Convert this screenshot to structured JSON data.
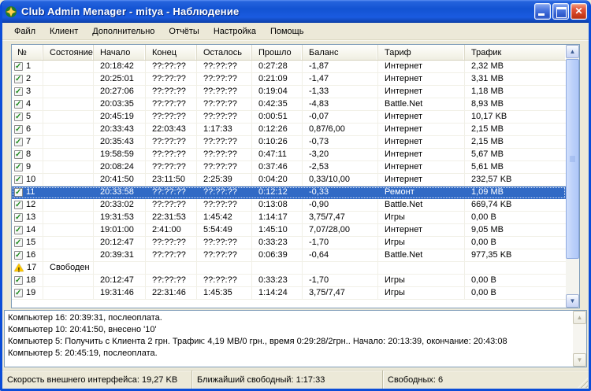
{
  "window": {
    "title": "Club Admin Menager - mitya - Наблюдение"
  },
  "menu": {
    "items": [
      "Файл",
      "Клиент",
      "Дополнительно",
      "Отчёты",
      "Настройка",
      "Помощь"
    ]
  },
  "table": {
    "columns": [
      "№",
      "Состояние",
      "Начало",
      "Конец",
      "Осталось",
      "Прошло",
      "Баланс",
      "Тариф",
      "Трафик"
    ],
    "rows": [
      {
        "n": "1",
        "icon": "checkbox-checked",
        "state": "",
        "start": "20:18:42",
        "end": "??:??:??",
        "remain": "??:??:??",
        "elapsed": "0:27:28",
        "balance": "-1,87",
        "tariff": "Интернет",
        "traffic": "2,32 MB",
        "selected": false
      },
      {
        "n": "2",
        "icon": "checkbox-checked",
        "state": "",
        "start": "20:25:01",
        "end": "??:??:??",
        "remain": "??:??:??",
        "elapsed": "0:21:09",
        "balance": "-1,47",
        "tariff": "Интернет",
        "traffic": "3,31 MB",
        "selected": false
      },
      {
        "n": "3",
        "icon": "checkbox-checked",
        "state": "",
        "start": "20:27:06",
        "end": "??:??:??",
        "remain": "??:??:??",
        "elapsed": "0:19:04",
        "balance": "-1,33",
        "tariff": "Интернет",
        "traffic": "1,18 MB",
        "selected": false
      },
      {
        "n": "4",
        "icon": "checkbox-checked",
        "state": "",
        "start": "20:03:35",
        "end": "??:??:??",
        "remain": "??:??:??",
        "elapsed": "0:42:35",
        "balance": "-4,83",
        "tariff": "Battle.Net",
        "traffic": "8,93 MB",
        "selected": false
      },
      {
        "n": "5",
        "icon": "checkbox-checked",
        "state": "",
        "start": "20:45:19",
        "end": "??:??:??",
        "remain": "??:??:??",
        "elapsed": "0:00:51",
        "balance": "-0,07",
        "tariff": "Интернет",
        "traffic": "10,17 KB",
        "selected": false
      },
      {
        "n": "6",
        "icon": "checkbox-checked",
        "state": "",
        "start": "20:33:43",
        "end": "22:03:43",
        "remain": "1:17:33",
        "elapsed": "0:12:26",
        "balance": "0,87/6,00",
        "tariff": "Интернет",
        "traffic": "2,15 MB",
        "selected": false
      },
      {
        "n": "7",
        "icon": "checkbox-checked",
        "state": "",
        "start": "20:35:43",
        "end": "??:??:??",
        "remain": "??:??:??",
        "elapsed": "0:10:26",
        "balance": "-0,73",
        "tariff": "Интернет",
        "traffic": "2,15 MB",
        "selected": false
      },
      {
        "n": "8",
        "icon": "checkbox-checked",
        "state": "",
        "start": "19:58:59",
        "end": "??:??:??",
        "remain": "??:??:??",
        "elapsed": "0:47:11",
        "balance": "-3,20",
        "tariff": "Интернет",
        "traffic": "5,67 MB",
        "selected": false
      },
      {
        "n": "9",
        "icon": "checkbox-checked",
        "state": "",
        "start": "20:08:24",
        "end": "??:??:??",
        "remain": "??:??:??",
        "elapsed": "0:37:46",
        "balance": "-2,53",
        "tariff": "Интернет",
        "traffic": "5,61 MB",
        "selected": false
      },
      {
        "n": "10",
        "icon": "checkbox-checked",
        "state": "",
        "start": "20:41:50",
        "end": "23:11:50",
        "remain": "2:25:39",
        "elapsed": "0:04:20",
        "balance": "0,33/10,00",
        "tariff": "Интернет",
        "traffic": "232,57 KB",
        "selected": false
      },
      {
        "n": "11",
        "icon": "checkbox-checked",
        "state": "",
        "start": "20:33:58",
        "end": "??:??:??",
        "remain": "??:??:??",
        "elapsed": "0:12:12",
        "balance": "-0,33",
        "tariff": "Ремонт",
        "traffic": "1,09 MB",
        "selected": true
      },
      {
        "n": "12",
        "icon": "checkbox-checked",
        "state": "",
        "start": "20:33:02",
        "end": "??:??:??",
        "remain": "??:??:??",
        "elapsed": "0:13:08",
        "balance": "-0,90",
        "tariff": "Battle.Net",
        "traffic": "669,74 KB",
        "selected": false
      },
      {
        "n": "13",
        "icon": "checkbox-checked",
        "state": "",
        "start": "19:31:53",
        "end": "22:31:53",
        "remain": "1:45:42",
        "elapsed": "1:14:17",
        "balance": "3,75/7,47",
        "tariff": "Игры",
        "traffic": "0,00 B",
        "selected": false
      },
      {
        "n": "14",
        "icon": "checkbox-checked",
        "state": "",
        "start": "19:01:00",
        "end": "2:41:00",
        "remain": "5:54:49",
        "elapsed": "1:45:10",
        "balance": "7,07/28,00",
        "tariff": "Интернет",
        "traffic": "9,05 MB",
        "selected": false
      },
      {
        "n": "15",
        "icon": "checkbox-checked",
        "state": "",
        "start": "20:12:47",
        "end": "??:??:??",
        "remain": "??:??:??",
        "elapsed": "0:33:23",
        "balance": "-1,70",
        "tariff": "Игры",
        "traffic": "0,00 B",
        "selected": false
      },
      {
        "n": "16",
        "icon": "checkbox-checked",
        "state": "",
        "start": "20:39:31",
        "end": "??:??:??",
        "remain": "??:??:??",
        "elapsed": "0:06:39",
        "balance": "-0,64",
        "tariff": "Battle.Net",
        "traffic": "977,35 KB",
        "selected": false
      },
      {
        "n": "17",
        "icon": "warning",
        "state": "Свободен",
        "start": "",
        "end": "",
        "remain": "",
        "elapsed": "",
        "balance": "",
        "tariff": "",
        "traffic": "",
        "selected": false
      },
      {
        "n": "18",
        "icon": "checkbox-checked",
        "state": "",
        "start": "20:12:47",
        "end": "??:??:??",
        "remain": "??:??:??",
        "elapsed": "0:33:23",
        "balance": "-1,70",
        "tariff": "Игры",
        "traffic": "0,00 B",
        "selected": false
      },
      {
        "n": "19",
        "icon": "checkbox-checked",
        "state": "",
        "start": "19:31:46",
        "end": "22:31:46",
        "remain": "1:45:35",
        "elapsed": "1:14:24",
        "balance": "3,75/7,47",
        "tariff": "Игры",
        "traffic": "0,00 B",
        "selected": false
      }
    ]
  },
  "log": {
    "lines": [
      "Компьютер 16: 20:39:31, послеоплата.",
      "Компьютер 10: 20:41:50, внесено '10'",
      "Компьютер 5: Получить с Клиента 2 грн. Трафик: 4,19 MB/0 грн., время 0:29:28/2грн.. Начало: 20:13:39, окончание: 20:43:08",
      "Компьютер 5: 20:45:19, послеоплата."
    ]
  },
  "statusbar": {
    "speed": "Скорость внешнего интерфейса: 19,27 KB",
    "next_free": "Ближайший свободный: 1:17:33",
    "free_count": "Свободных: 6"
  },
  "icons": {
    "app": "green-star-badge",
    "minimize": "underscore-bar",
    "maximize": "window-outline",
    "close": "✕",
    "row-active": "checkbox-with-green-check",
    "row-free": "yellow-warning-triangle",
    "scroll-up": "▲",
    "scroll-down": "▼"
  },
  "colors": {
    "selection": "#316AC5",
    "titlebar_blue": "#1353D2",
    "window_border": "#0B4DD8",
    "face": "#ECE9D8",
    "warning_yellow": "#FBC500"
  },
  "glyphs": {
    "up": "▲",
    "down": "▼"
  }
}
